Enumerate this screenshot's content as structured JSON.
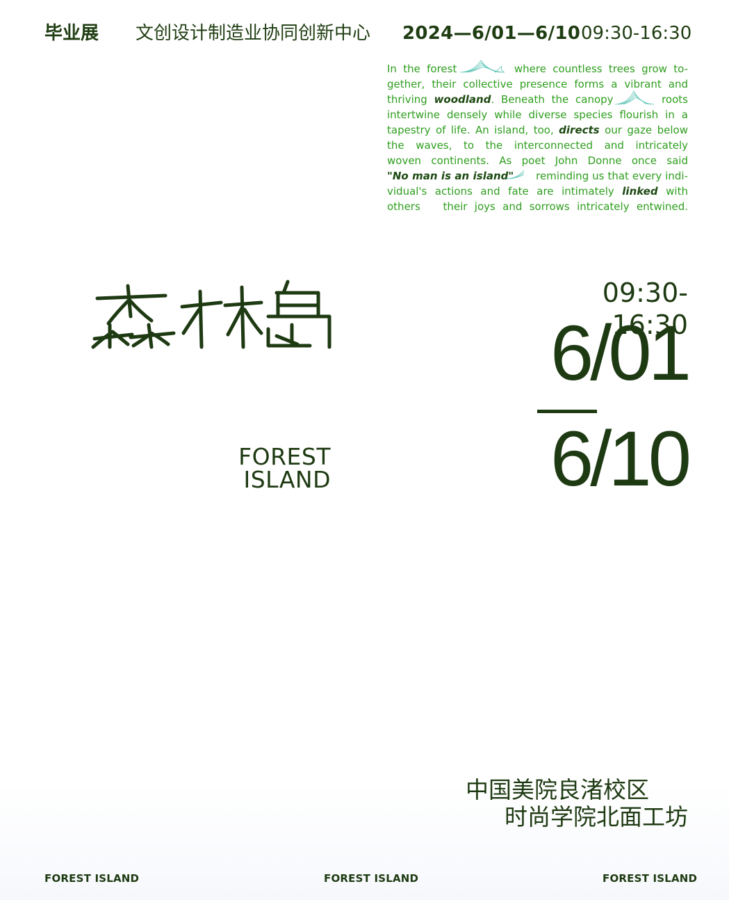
{
  "header": {
    "exhibit": "毕业展",
    "organizer": "文创设计制造业协同创新中心",
    "dates": "2024—6/01—6/10",
    "time": "09:30-16:30"
  },
  "paragraph": {
    "l1a": "In the forest",
    "l1b": "where countless trees grow to-",
    "l2": "gether, their collective presence forms a vibrant and",
    "l3a": "thriving",
    "l3b": "woodland",
    "l3c": ". Beneath the canopy",
    "l3d": "roots",
    "l4": "intertwine densely while diverse species flourish in a",
    "l5a": "tapestry of life. An island, too,",
    "l5b": "directs",
    "l5c": "our gaze below",
    "l6": "the waves, to the interconnected and intricately",
    "l7": "woven continents. As poet John Donne once said",
    "l8a": "\"No man is an island\"",
    "l8b": "reminding us that every indi-",
    "l9a": "vidual's actions and fate are intimately",
    "l9b": "linked",
    "l9c": "with",
    "l10a": "others",
    "l10b": "their joys and sorrows intricately entwined."
  },
  "title": {
    "en": "FOREST ISLAND",
    "en_line1": "FOREST",
    "en_line2": "ISLAND"
  },
  "schedule": {
    "time": "09:30-16:30",
    "start": "6/01",
    "end": "6/10"
  },
  "venue": {
    "line1": "中国美院良渚校区",
    "line2": "时尚学院北面工坊"
  },
  "footer": {
    "left": "FOREST ISLAND",
    "center": "FOREST ISLAND",
    "right": "FOREST ISLAND"
  },
  "colors": {
    "dark_green": "#1e3a12",
    "text_green": "#2e9e1e",
    "wave_teal": "#5cc5b6",
    "background": "#ffffff"
  }
}
